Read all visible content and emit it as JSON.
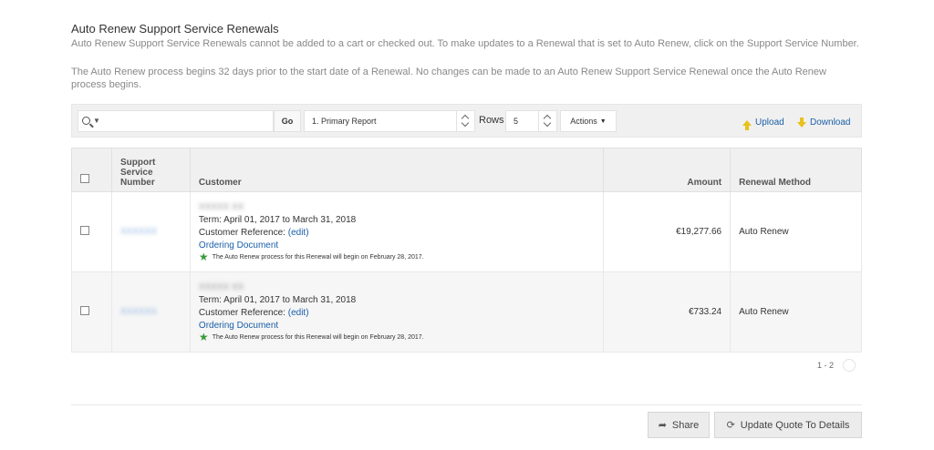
{
  "header": {
    "title": "Auto Renew Support Service Renewals",
    "description_1": "Auto Renew Support Service Renewals cannot be added to a cart or checked out. To make updates to a Renewal that is set to Auto Renew, click on the Support Service Number.",
    "description_2": "The Auto Renew process begins 32 days prior to the start date of a Renewal. No changes can be made to an Auto Renew Support Service Renewal once the Auto Renew process begins."
  },
  "toolbar": {
    "search_placeholder": "",
    "go_label": "Go",
    "report_selected": "1. Primary Report",
    "rows_label": "Rows",
    "rows_selected": "5",
    "actions_label": "Actions",
    "upload_label": "Upload",
    "download_label": "Download"
  },
  "table": {
    "headers": {
      "support_number": "Support Service Number",
      "customer": "Customer",
      "amount": "Amount",
      "renewal_method": "Renewal Method"
    },
    "rows": [
      {
        "support_number": "XXXXXX",
        "customer_name": "XXXXX XX",
        "term": "Term: April 01, 2017 to March 31, 2018",
        "customer_reference": "Customer Reference:",
        "edit_label": "(edit)",
        "ordering_document": "Ordering Document",
        "note": "The Auto Renew process for this Renewal will begin on February 28, 2017.",
        "amount": "€19,277.66",
        "renewal_method": "Auto Renew"
      },
      {
        "support_number": "XXXXXX",
        "customer_name": "XXXXX XX",
        "term": "Term: April 01, 2017 to March 31, 2018",
        "customer_reference": "Customer Reference:",
        "edit_label": "(edit)",
        "ordering_document": "Ordering Document",
        "note": "The Auto Renew process for this Renewal will begin on February 28, 2017.",
        "amount": "€733.24",
        "renewal_method": "Auto Renew"
      }
    ]
  },
  "pagination": {
    "range": "1 - 2"
  },
  "footer": {
    "share_label": "Share",
    "update_label": "Update Quote To Details"
  }
}
